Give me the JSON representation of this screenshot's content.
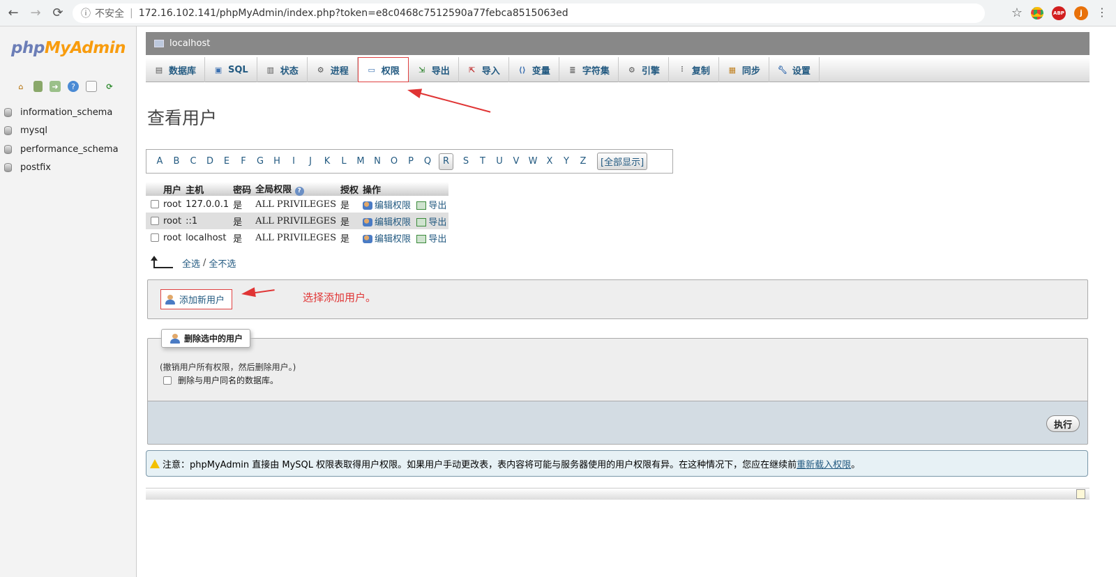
{
  "browser": {
    "back": "←",
    "forward": "→",
    "reload": "⟳",
    "info": "ⓘ",
    "insecure_label": "不安全",
    "url": "172.16.102.141/phpMyAdmin/index.php?token=e8c0468c7512590a77febca8515063ed",
    "star": "☆",
    "abp": "ABP",
    "profile": "j",
    "menu": "⋮"
  },
  "logo": {
    "php": "php",
    "myadmin": "MyAdmin"
  },
  "nav_icons": [
    "home-icon",
    "sql-window-icon",
    "logout-icon",
    "help-icon",
    "docs-icon",
    "reload-icon"
  ],
  "databases": [
    "information_schema",
    "mysql",
    "performance_schema",
    "postfix"
  ],
  "server": {
    "name": "localhost"
  },
  "tabs": [
    {
      "label": "数据库",
      "icon": "database-icon"
    },
    {
      "label": "SQL",
      "icon": "sql-icon"
    },
    {
      "label": "状态",
      "icon": "status-icon"
    },
    {
      "label": "进程",
      "icon": "process-icon"
    },
    {
      "label": "权限",
      "icon": "privileges-icon",
      "active": true
    },
    {
      "label": "导出",
      "icon": "export-icon"
    },
    {
      "label": "导入",
      "icon": "import-icon"
    },
    {
      "label": "变量",
      "icon": "variables-icon"
    },
    {
      "label": "字符集",
      "icon": "charset-icon"
    },
    {
      "label": "引擎",
      "icon": "engine-icon"
    },
    {
      "label": "复制",
      "icon": "replication-icon"
    },
    {
      "label": "同步",
      "icon": "sync-icon"
    },
    {
      "label": "设置",
      "icon": "settings-icon"
    }
  ],
  "page_title": "查看用户",
  "alphabet": [
    "A",
    "B",
    "C",
    "D",
    "E",
    "F",
    "G",
    "H",
    "I",
    "J",
    "K",
    "L",
    "M",
    "N",
    "O",
    "P",
    "Q",
    "R",
    "S",
    "T",
    "U",
    "V",
    "W",
    "X",
    "Y",
    "Z"
  ],
  "alphabet_current": "R",
  "show_all": "[全部显示]",
  "table": {
    "headers": [
      "用户",
      "主机",
      "密码",
      "全局权限",
      "授权",
      "操作"
    ],
    "rows": [
      {
        "user": "root",
        "host": "127.0.0.1",
        "password": "是",
        "privileges": "ALL PRIVILEGES",
        "grant": "是",
        "edit": "编辑权限",
        "export": "导出"
      },
      {
        "user": "root",
        "host": "::1",
        "password": "是",
        "privileges": "ALL PRIVILEGES",
        "grant": "是",
        "edit": "编辑权限",
        "export": "导出"
      },
      {
        "user": "root",
        "host": "localhost",
        "password": "是",
        "privileges": "ALL PRIVILEGES",
        "grant": "是",
        "edit": "编辑权限",
        "export": "导出"
      }
    ]
  },
  "select_all": "全选",
  "select_sep": "/",
  "unselect_all": "全不选",
  "add_user": "添加新用户",
  "annotation": "选择添加用户。",
  "delete": {
    "legend": "删除选中的用户",
    "description": "(撤销用户所有权限，然后删除用户。)",
    "drop_db_label": "删除与用户同名的数据库。",
    "go_button": "执行"
  },
  "notice": {
    "text": "注意：phpMyAdmin 直接由 MySQL 权限表取得用户权限。如果用户手动更改表，表内容将可能与服务器使用的用户权限有异。在这种情况下，您应在继续前",
    "link": "重新载入权限",
    "end": "。"
  },
  "colors": {
    "annotation_red": "#e03434",
    "link_blue": "#235a81",
    "logo_blue": "#6c7eb7",
    "logo_orange": "#f89c0e"
  }
}
